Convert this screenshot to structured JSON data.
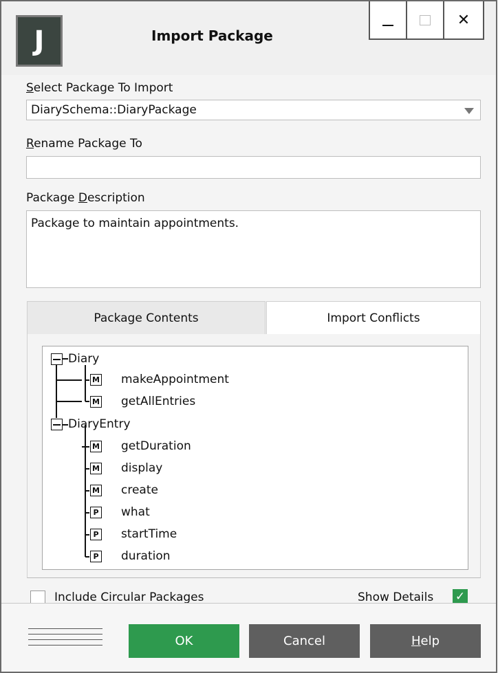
{
  "window": {
    "title": "Import Package",
    "app_icon_letter": "J",
    "controls": {
      "close": "✕"
    }
  },
  "form": {
    "select_label_first": "S",
    "select_label_rest": "elect Package To Import",
    "select_value": "DiarySchema::DiaryPackage",
    "rename_label_first": "R",
    "rename_label_rest": "ename Package To",
    "rename_value": "",
    "description_label_pre": "Package ",
    "description_label_u": "D",
    "description_label_rest": "escription",
    "description_value": "Package to maintain appointments."
  },
  "tabs": [
    {
      "label": "Package Contents",
      "active": true
    },
    {
      "label": "Import Conflicts",
      "active": false
    }
  ],
  "tree": {
    "nodes": [
      {
        "label": "Diary",
        "type": "class",
        "expanded": true
      },
      {
        "label": "makeAppointment",
        "type": "method",
        "badge": "M"
      },
      {
        "label": "getAllEntries",
        "type": "method",
        "badge": "M"
      },
      {
        "label": "DiaryEntry",
        "type": "class",
        "expanded": true
      },
      {
        "label": "getDuration",
        "type": "method",
        "badge": "M"
      },
      {
        "label": "display",
        "type": "method",
        "badge": "M"
      },
      {
        "label": "create",
        "type": "method",
        "badge": "M"
      },
      {
        "label": "what",
        "type": "property",
        "badge": "P"
      },
      {
        "label": "startTime",
        "type": "property",
        "badge": "P"
      },
      {
        "label": "duration",
        "type": "property",
        "badge": "P"
      }
    ]
  },
  "options": {
    "include_circular_label": "Include Circular Packages",
    "include_circular_checked": false,
    "show_details_label": "Show Details",
    "show_details_checked": true,
    "check_mark": "✓"
  },
  "buttons": {
    "ok": "OK",
    "cancel": "Cancel",
    "help_first": "H",
    "help_rest": "elp"
  },
  "colors": {
    "accent_green": "#2e9a4e",
    "button_gray": "#5f5f5f"
  }
}
